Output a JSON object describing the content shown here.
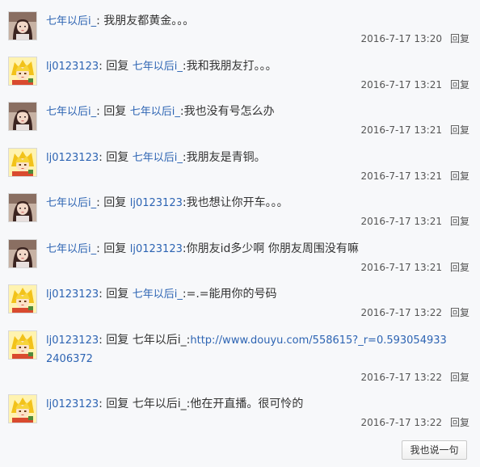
{
  "replies": [
    {
      "author": "七年以后i_",
      "avatar": "avatar-girl",
      "reply_word": "",
      "target": "",
      "sep": ":",
      "text": "我朋友都黄金。。。",
      "url": "",
      "time": "2016-7-17 13:20",
      "reply_label": "回复"
    },
    {
      "author": "lj0123123",
      "avatar": "avatar-blond",
      "reply_word": "回复",
      "target": "七年以后i_",
      "sep": ":",
      "text": "我和我朋友打。。。",
      "url": "",
      "time": "2016-7-17 13:21",
      "reply_label": "回复"
    },
    {
      "author": "七年以后i_",
      "avatar": "avatar-girl",
      "reply_word": "回复",
      "target": "七年以后i_",
      "sep": ":",
      "text": "我也没有号怎么办",
      "url": "",
      "time": "2016-7-17 13:21",
      "reply_label": "回复"
    },
    {
      "author": "lj0123123",
      "avatar": "avatar-blond",
      "reply_word": "回复",
      "target": "七年以后i_",
      "sep": ":",
      "text": "我朋友是青铜。",
      "url": "",
      "time": "2016-7-17 13:21",
      "reply_label": "回复"
    },
    {
      "author": "七年以后i_",
      "avatar": "avatar-girl",
      "reply_word": "回复",
      "target": "lj0123123",
      "sep": ":",
      "text": "我也想让你开车。。。",
      "url": "",
      "time": "2016-7-17 13:21",
      "reply_label": "回复"
    },
    {
      "author": "七年以后i_",
      "avatar": "avatar-girl",
      "reply_word": "回复",
      "target": "lj0123123",
      "sep": ":",
      "text": "你朋友id多少啊 你朋友周围没有嘛",
      "url": "",
      "time": "2016-7-17 13:21",
      "reply_label": "回复"
    },
    {
      "author": "lj0123123",
      "avatar": "avatar-blond",
      "reply_word": "回复",
      "target": "七年以后i_",
      "sep": ":",
      "text": "=.=能用你的号码",
      "url": "",
      "time": "2016-7-17 13:22",
      "reply_label": "回复"
    },
    {
      "author": "lj0123123",
      "avatar": "avatar-blond",
      "reply_word": "回复",
      "target": "七年以后i_",
      "sep": ":",
      "text": "",
      "url": "http://www.douyu.com/558615?_r=0.5930549332406372",
      "time": "2016-7-17 13:22",
      "reply_label": "回复"
    },
    {
      "author": "lj0123123",
      "avatar": "avatar-blond",
      "reply_word": "回复",
      "target": "七年以后i_",
      "sep": ":",
      "text": "他在开直播。很可怜的",
      "url": "",
      "time": "2016-7-17 13:22",
      "reply_label": "回复"
    }
  ],
  "say_button": "我也说一句",
  "colors": {
    "link": "#2d64b3",
    "text": "#333333",
    "background": "#f7f8fa"
  }
}
